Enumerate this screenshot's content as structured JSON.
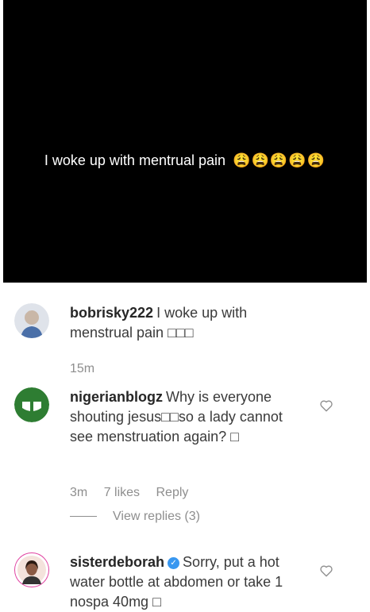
{
  "story": {
    "text": "I woke up with mentrual pain",
    "emojis": "😩😩😩😩😩"
  },
  "comments": [
    {
      "username": "bobrisky222",
      "text": "I woke up with menstrual pain □□□",
      "time": "15m"
    },
    {
      "username": "nigerianblogz",
      "text": "Why is everyone shouting jesus□□so a lady cannot see menstruation again? □",
      "time": "3m",
      "likes": "7 likes",
      "reply": "Reply",
      "view_replies": "View replies (3)"
    },
    {
      "username": "sisterdeborah",
      "text": "Sorry, put a hot water bottle at abdomen or take 1 nospa 40mg □"
    }
  ],
  "icons": {
    "heart": "heart-icon",
    "verified": "verified-badge-icon"
  },
  "colors": {
    "verified": "#3897f0",
    "nigerianblogz_avatar": "#2e7d32"
  }
}
